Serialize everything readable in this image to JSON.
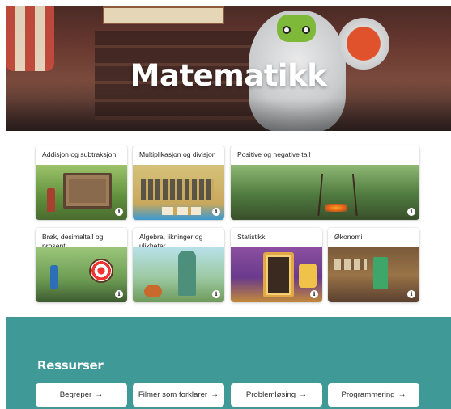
{
  "hero": {
    "title": "Matematikk"
  },
  "topics": [
    {
      "label": "Addisjon og subtraksjon",
      "name": "addisjon-og-subtraksjon",
      "info_icon": "info-icon"
    },
    {
      "label": "Multiplikasjon og divisjon",
      "name": "multiplikasjon-og-divisjon",
      "info_icon": "info-icon"
    },
    {
      "label": "Positive og negative tall",
      "name": "positive-og-negative-tall",
      "info_icon": "info-icon"
    },
    {
      "label": "Brøk, desimaltall og prosent",
      "name": "brok-desimaltall-og-prosent",
      "info_icon": "info-icon"
    },
    {
      "label": "Algebra, likninger og ulikheter",
      "name": "algebra-likninger-og-ulikheter",
      "info_icon": "info-icon"
    },
    {
      "label": "Statistikk",
      "name": "statistikk",
      "info_icon": "info-icon"
    },
    {
      "label": "Økonomi",
      "name": "okonomi",
      "info_icon": "info-icon"
    }
  ],
  "info_glyph": "i",
  "resources": {
    "heading": "Ressurser",
    "arrow": "→",
    "buttons": [
      {
        "label": "Begreper"
      },
      {
        "label": "Filmer som forklarer"
      },
      {
        "label": "Problemløsing"
      },
      {
        "label": "Programmering"
      }
    ]
  },
  "colors": {
    "resources_background": "#3f9a97",
    "card_background": "#ffffff",
    "hero_title": "#ffffff"
  }
}
